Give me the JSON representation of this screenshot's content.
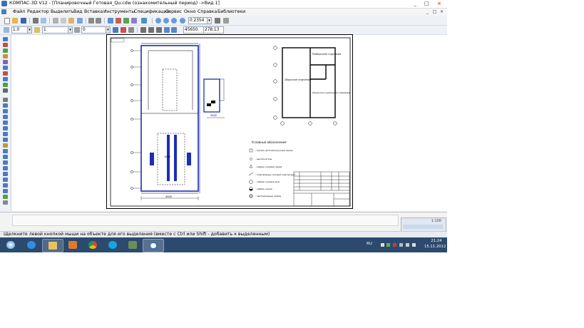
{
  "window": {
    "title": "КОМПАС-3D V12 - [Планировочный Готовая_Qu.cdw (ознакомительный период) ->Вид 1]",
    "controls": [
      "_",
      "□",
      "×"
    ],
    "doc_controls": [
      "_",
      "□",
      "×"
    ]
  },
  "menu": [
    "Файл",
    "Редактор",
    "Выделить",
    "Вид",
    "Вставка",
    "Инструменты",
    "Спецификация",
    "Сервис",
    "Окно",
    "Справка",
    "Библиотеки"
  ],
  "toolbar": {
    "zoom_value": "0.2354",
    "coord_x": "45650.",
    "coord_y": "278.13",
    "scale_value": "1.0",
    "layer_value": "1",
    "style_value": "0"
  },
  "drawing": {
    "legend_title": "Условные обозначения",
    "legend_items": [
      "- патрон фотоимпульсный лампа",
      "- выключатель",
      "- кабель силовая линия",
      "- ответвление силовой электрощит",
      "- кабель силовой дом",
      "- кабель линия",
      "- светодиодные лампы"
    ],
    "rooms": [
      "Сборочное отделение",
      "Разборочное отделение",
      "Окрасочно-сушильное отделение"
    ],
    "dim_labels": [
      "1000",
      "2000",
      "4000"
    ],
    "axis_marks": [
      "1",
      "2",
      "3",
      "4",
      "5",
      "6",
      "7",
      "8",
      "9",
      "А",
      "Б",
      "В"
    ]
  },
  "status": {
    "message": "Щелкните левой кнопкой мыши на объекте для его выделения (вместе с Ctrl или Shift - добавить к выделенным)"
  },
  "prop_panel": {
    "value": "1:100"
  },
  "taskbar": {
    "lang": "RU",
    "time": "21:24",
    "date": "15.11.2012"
  }
}
